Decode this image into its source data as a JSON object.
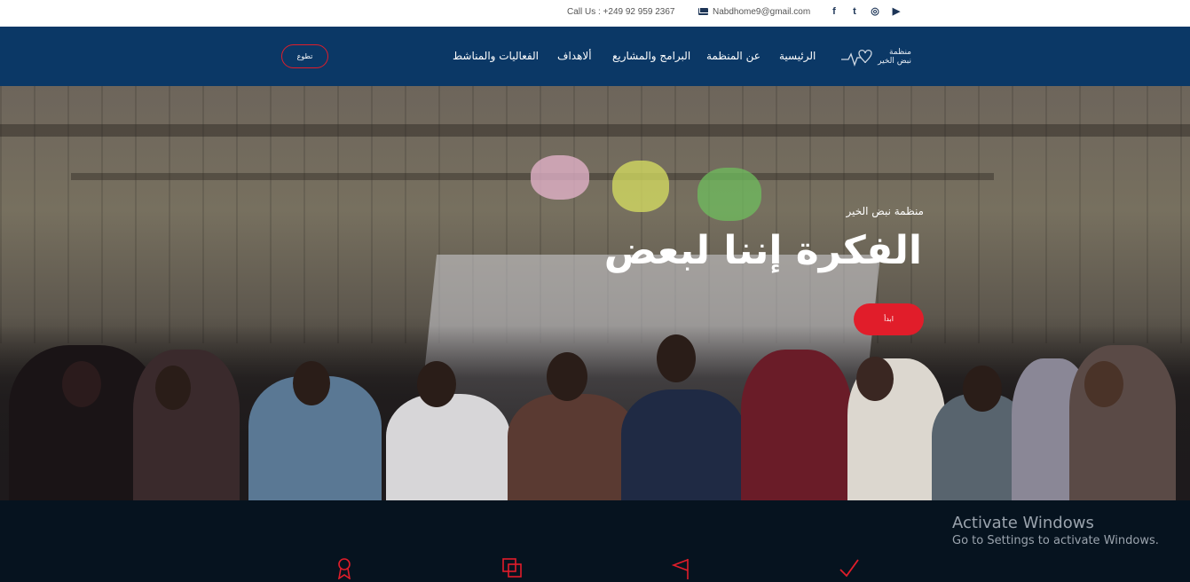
{
  "topbar": {
    "call": "Call Us : +249 92 959 2367",
    "email": "Nabdhome9@gmail.com",
    "social": [
      {
        "icon": "facebook-icon",
        "glyph": "f"
      },
      {
        "icon": "twitter-icon",
        "glyph": "t"
      },
      {
        "icon": "instagram-icon",
        "glyph": "◎"
      },
      {
        "icon": "youtube-icon",
        "glyph": "▶"
      }
    ]
  },
  "nav": {
    "logo_text": "منظمة نبض الخير",
    "items": [
      "الرئيسية",
      "عن المنظمة",
      "البرامج والمشاريع",
      "ألاهداف",
      "الفعاليات والمناشط"
    ],
    "volunteer": "تطوع"
  },
  "hero": {
    "kicker": "منظمة نبض الخير",
    "title": "الفكرة إننا لبعض",
    "button": "ابدأ"
  },
  "features": {
    "icons": [
      "ribbon-icon",
      "copy-icon",
      "flag-icon",
      "check-icon"
    ]
  },
  "watermark": {
    "title": "Activate Windows",
    "subtitle": "Go to Settings to activate Windows."
  },
  "colors": {
    "nav_bg": "#0b3866",
    "accent": "#e11d2a",
    "band_bg": "#06131f"
  }
}
